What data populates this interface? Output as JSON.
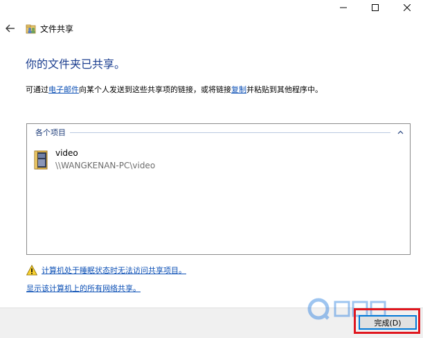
{
  "window": {
    "controls": {
      "minimize_icon": "minimize-icon",
      "maximize_icon": "maximize-icon",
      "close_icon": "close-icon"
    }
  },
  "header": {
    "back_icon": "back-arrow-icon",
    "app_icon": "file-sharing-icon",
    "title": "文件共享"
  },
  "main": {
    "heading": "你的文件夹已共享。",
    "description": {
      "part1": "可通过",
      "email_link": "电子邮件",
      "part2": "向某个人发送到这些共享项的链接，或将链接",
      "copy_link": "复制",
      "part3": "并粘贴到其他程序中。"
    },
    "items_group": {
      "label": "各个项目",
      "items": [
        {
          "name": "video",
          "path": "\\\\WANGKENAN-PC\\video",
          "icon": "folder-icon"
        }
      ]
    },
    "warning_link": "计算机处于睡眠状态时无法访问共享项目。",
    "network_link": "显示该计算机上的所有网络共享。"
  },
  "footer": {
    "finish_label": "完成(D)"
  },
  "colors": {
    "heading": "#1a3d8f",
    "link": "#0b4fb5",
    "highlight": "#e0161e",
    "button_border": "#0078d7"
  }
}
